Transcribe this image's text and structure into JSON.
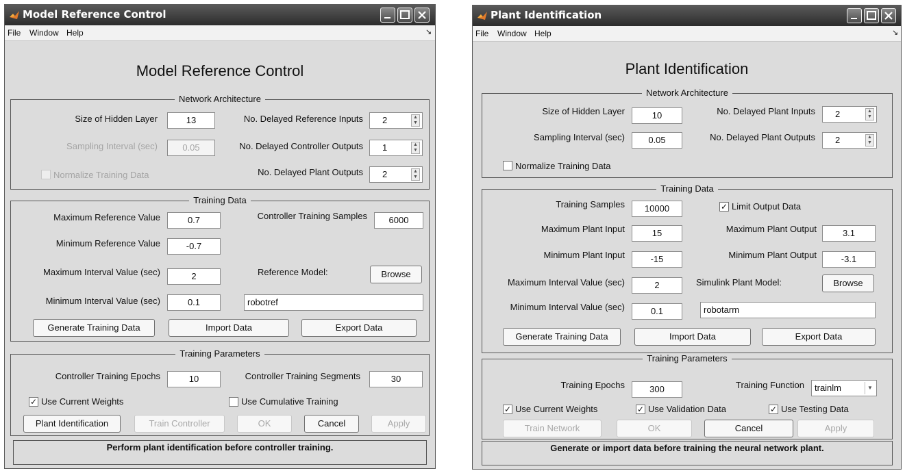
{
  "menu_items": [
    "File",
    "Window",
    "Help"
  ],
  "menu_corner_glyph": "↘",
  "mrc": {
    "window_title": "Model Reference Control",
    "heading": "Model Reference Control",
    "net_arch": {
      "title": "Network Architecture",
      "hidden_label": "Size of Hidden Layer",
      "hidden_value": "13",
      "sampling_label": "Sampling Interval (sec)",
      "sampling_value": "0.05",
      "normalize_label": "Normalize Training Data",
      "ref_inputs_label": "No. Delayed Reference Inputs",
      "ref_inputs_value": "2",
      "ctrl_outputs_label": "No. Delayed Controller Outputs",
      "ctrl_outputs_value": "1",
      "plant_outputs_label": "No. Delayed Plant Outputs",
      "plant_outputs_value": "2"
    },
    "training_data": {
      "title": "Training Data",
      "max_ref_label": "Maximum Reference Value",
      "max_ref_value": "0.7",
      "min_ref_label": "Minimum Reference Value",
      "min_ref_value": "-0.7",
      "max_int_label": "Maximum Interval Value (sec)",
      "max_int_value": "2",
      "min_int_label": "Minimum Interval Value (sec)",
      "min_int_value": "0.1",
      "ctrl_samples_label": "Controller Training Samples",
      "ctrl_samples_value": "6000",
      "ref_model_label": "Reference Model:",
      "browse": "Browse",
      "ref_model_value": "robotref",
      "generate": "Generate Training Data",
      "import": "Import Data",
      "export": "Export Data"
    },
    "training_params": {
      "title": "Training Parameters",
      "epochs_label": "Controller Training Epochs",
      "epochs_value": "10",
      "segments_label": "Controller Training Segments",
      "segments_value": "30",
      "use_weights": "Use Current Weights",
      "use_cumulative": "Use Cumulative Training",
      "plant_id": "Plant Identification",
      "train": "Train Controller",
      "ok": "OK",
      "cancel": "Cancel",
      "apply": "Apply"
    },
    "status": "Perform plant identification before controller training."
  },
  "pid": {
    "window_title": "Plant Identification",
    "heading": "Plant Identification",
    "net_arch": {
      "title": "Network Architecture",
      "hidden_label": "Size of Hidden Layer",
      "hidden_value": "10",
      "sampling_label": "Sampling Interval (sec)",
      "sampling_value": "0.05",
      "normalize_label": "Normalize Training Data",
      "plant_inputs_label": "No. Delayed Plant Inputs",
      "plant_inputs_value": "2",
      "plant_outputs_label": "No. Delayed Plant Outputs",
      "plant_outputs_value": "2"
    },
    "training_data": {
      "title": "Training Data",
      "samples_label": "Training Samples",
      "samples_value": "10000",
      "limit_label": "Limit Output Data",
      "max_in_label": "Maximum Plant Input",
      "max_in_value": "15",
      "min_in_label": "Minimum Plant Input",
      "min_in_value": "-15",
      "max_out_label": "Maximum Plant Output",
      "max_out_value": "3.1",
      "min_out_label": "Minimum Plant Output",
      "min_out_value": "-3.1",
      "max_int_label": "Maximum Interval Value (sec)",
      "max_int_value": "2",
      "min_int_label": "Minimum Interval Value (sec)",
      "min_int_value": "0.1",
      "model_label": "Simulink Plant Model:",
      "browse": "Browse",
      "model_value": "robotarm",
      "generate": "Generate Training Data",
      "import": "Import Data",
      "export": "Export Data"
    },
    "training_params": {
      "title": "Training Parameters",
      "epochs_label": "Training Epochs",
      "epochs_value": "300",
      "function_label": "Training Function",
      "function_value": "trainlm",
      "use_weights": "Use Current Weights",
      "use_validation": "Use Validation Data",
      "use_testing": "Use Testing Data",
      "train": "Train Network",
      "ok": "OK",
      "cancel": "Cancel",
      "apply": "Apply"
    },
    "status": "Generate or import data before training the neural network plant."
  }
}
